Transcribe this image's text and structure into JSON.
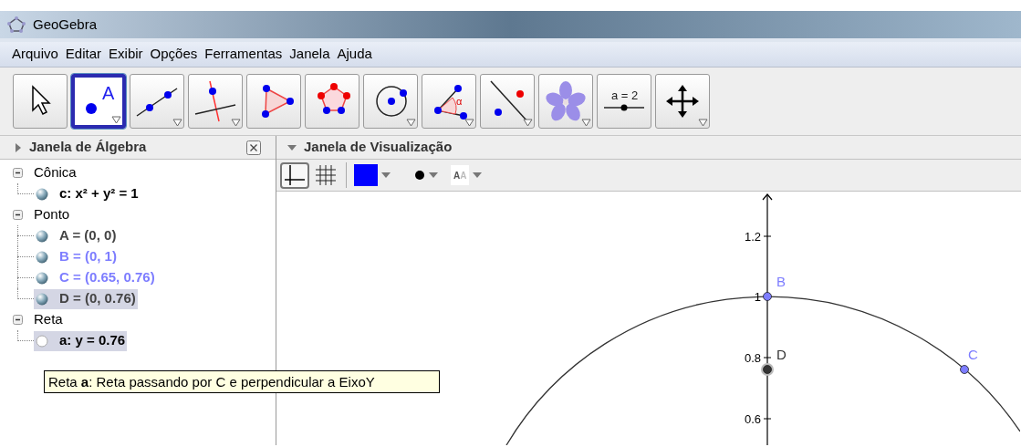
{
  "window": {
    "title": "GeoGebra"
  },
  "menu": [
    "Arquivo",
    "Editar",
    "Exibir",
    "Opções",
    "Ferramentas",
    "Janela",
    "Ajuda"
  ],
  "tools": [
    {
      "kind": "move",
      "selected": false,
      "has_menu": false
    },
    {
      "kind": "point",
      "selected": true,
      "has_menu": true,
      "text": "A"
    },
    {
      "kind": "line",
      "selected": false,
      "has_menu": true
    },
    {
      "kind": "perpendicular",
      "selected": false,
      "has_menu": true
    },
    {
      "kind": "polygon",
      "selected": false,
      "has_menu": false
    },
    {
      "kind": "regular-polygon",
      "selected": false,
      "has_menu": false
    },
    {
      "kind": "circle",
      "selected": false,
      "has_menu": true
    },
    {
      "kind": "angle",
      "selected": false,
      "has_menu": true,
      "text": "α"
    },
    {
      "kind": "reflect",
      "selected": false,
      "has_menu": true
    },
    {
      "kind": "flower",
      "selected": false,
      "has_menu": true
    },
    {
      "kind": "slider",
      "selected": false,
      "has_menu": false,
      "text": "a = 2"
    },
    {
      "kind": "move-view",
      "selected": false,
      "has_menu": true
    }
  ],
  "algebra_view": {
    "title": "Janela de Álgebra",
    "expanded": false,
    "groups": [
      {
        "label": "Cônica",
        "expanded": true,
        "items": [
          {
            "text": "c: x² + y² = 1",
            "color": "#000000",
            "visible": true,
            "selected": false
          }
        ]
      },
      {
        "label": "Ponto",
        "expanded": true,
        "items": [
          {
            "text": "A = (0, 0)",
            "color": "#444444",
            "visible": true,
            "selected": false
          },
          {
            "text": "B = (0, 1)",
            "color": "#7d7dff",
            "visible": true,
            "selected": false
          },
          {
            "text": "C = (0.65, 0.76)",
            "color": "#7d7dff",
            "visible": true,
            "selected": false
          },
          {
            "text": "D = (0, 0.76)",
            "color": "#444444",
            "visible": true,
            "selected": true
          }
        ]
      },
      {
        "label": "Reta",
        "expanded": true,
        "items": [
          {
            "text": "a: y = 0.76",
            "color": "#000000",
            "visible": false,
            "selected": true
          }
        ]
      }
    ],
    "tooltip": "Reta **a**: Reta passando por C e perpendicular a EixoY"
  },
  "graphics_view": {
    "title": "Janela de Visualização",
    "expanded": true,
    "style_bar": {
      "axes_on": true,
      "grid_on": false,
      "color": "#0000ff",
      "label_style": [
        "A",
        "A"
      ]
    },
    "y_ticks": [
      "1.2",
      "1",
      "0.8",
      "0.6"
    ],
    "points": [
      {
        "label": "B",
        "color": "#7d7dff"
      },
      {
        "label": "C",
        "color": "#7d7dff"
      },
      {
        "label": "D",
        "color": "#333333"
      }
    ]
  }
}
